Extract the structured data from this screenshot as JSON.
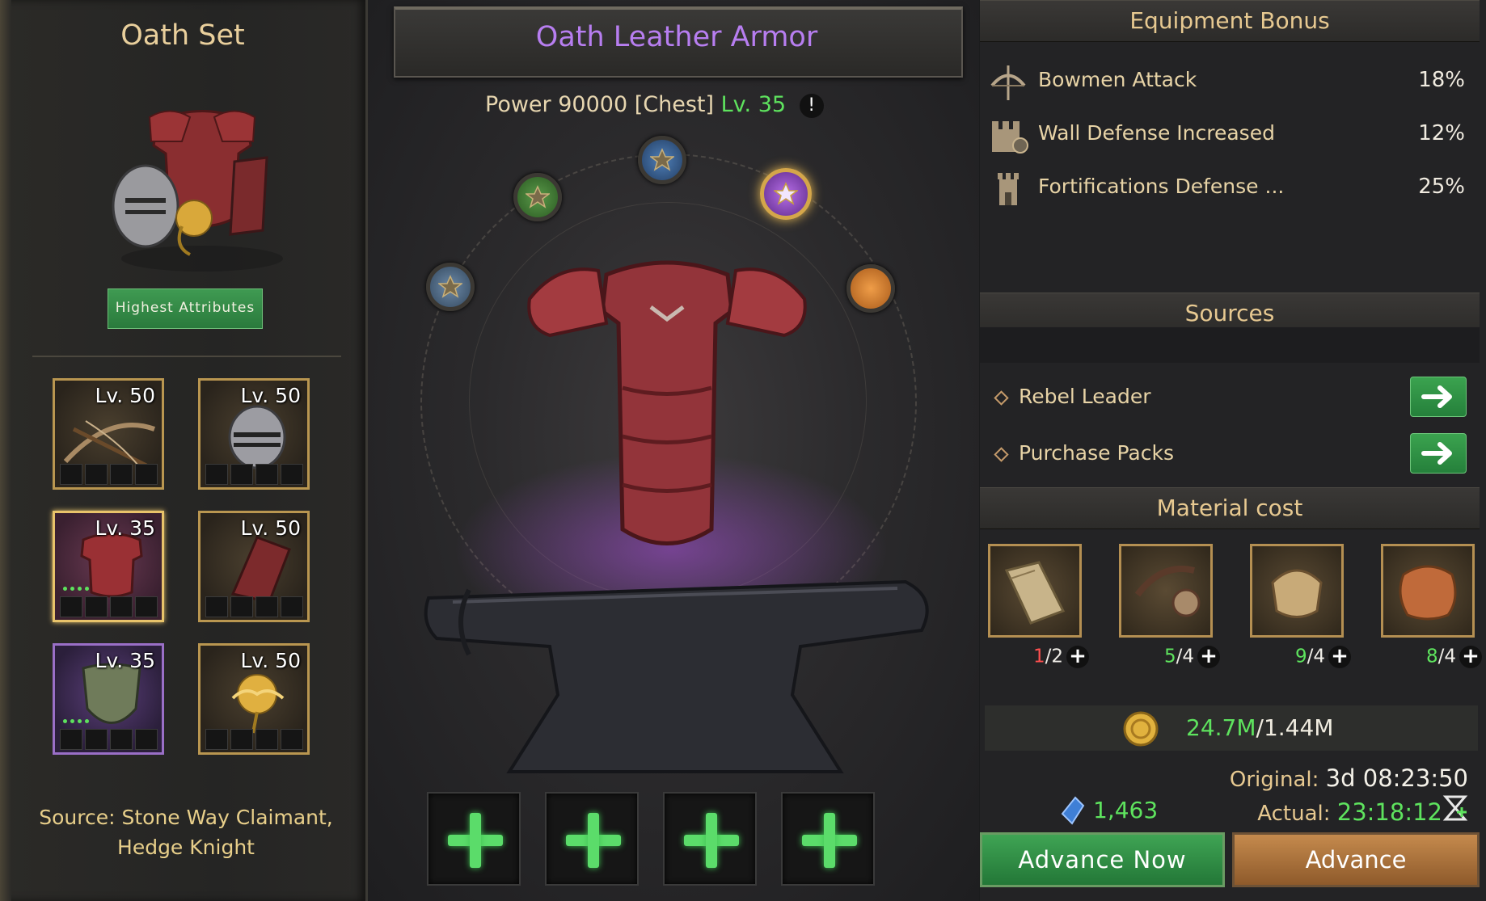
{
  "set": {
    "title": "Oath Set",
    "highlight_button": "Highest Attributes",
    "pieces": [
      {
        "level": "Lv. 50",
        "icon": "crossbow-icon"
      },
      {
        "level": "Lv. 50",
        "icon": "helmet-icon"
      },
      {
        "level": "Lv. 35",
        "icon": "chest-armor-icon"
      },
      {
        "level": "Lv. 50",
        "icon": "bracer-icon"
      },
      {
        "level": "Lv. 35",
        "icon": "shield-icon"
      },
      {
        "level": "Lv. 50",
        "icon": "rose-trinket-icon"
      }
    ],
    "source_line1": "Source: Stone Way Claimant,",
    "source_line2": "Hedge Knight"
  },
  "item": {
    "name": "Oath Leather Armor",
    "power_label": "Power",
    "power_value": "90000",
    "slot": "[Chest]",
    "level": "Lv. 35",
    "info": "!"
  },
  "equipment_bonus": {
    "title": "Equipment Bonus",
    "rows": [
      {
        "label": "Bowmen Attack",
        "value": "18%",
        "icon": "bow-icon"
      },
      {
        "label": "Wall Defense Increased",
        "value": "12%",
        "icon": "wall-icon"
      },
      {
        "label": "Fortifications Defense ...",
        "value": "25%",
        "icon": "tower-icon"
      }
    ]
  },
  "sources": {
    "title": "Sources",
    "rows": [
      {
        "label": "Rebel Leader"
      },
      {
        "label": "Purchase Packs"
      }
    ]
  },
  "material_cost": {
    "title": "Material cost",
    "items": [
      {
        "have": "1",
        "need": "/2",
        "status": "insufficient"
      },
      {
        "have": "5",
        "need": "/4",
        "status": "enough"
      },
      {
        "have": "9",
        "need": "/4",
        "status": "enough"
      },
      {
        "have": "8",
        "need": "/4",
        "status": "enough"
      }
    ],
    "gold_have": "24.7M",
    "gold_need": "/1.44M",
    "crystals": "1,463"
  },
  "timers": {
    "original_label": "Original:",
    "original_value": "3d 08:23:50",
    "actual_label": "Actual:",
    "actual_value": "23:18:12"
  },
  "buttons": {
    "advance_now": "Advance Now",
    "advance": "Advance"
  },
  "colors": {
    "item_name": "#b77ef0",
    "accent_green": "#5ee35e",
    "warning_red": "#ff4f4f",
    "gold_text": "#e7c991"
  }
}
